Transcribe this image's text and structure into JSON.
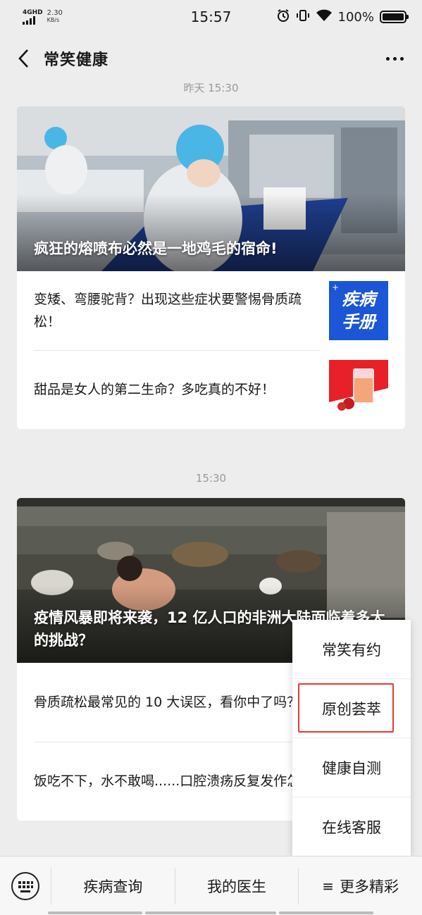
{
  "status_bar": {
    "network": "4GHD",
    "speed_value": "2.30",
    "speed_unit": "KB/s",
    "time": "15:57",
    "battery": "100%"
  },
  "nav": {
    "title": "常笑健康",
    "back_icon": "back-chevron-icon",
    "more_icon": "more-dots-icon"
  },
  "groups": [
    {
      "timestamp": "昨天 15:30",
      "hero_title": "疯狂的熔喷布必然是一地鸡毛的宿命!",
      "items": [
        {
          "title": "变矮、弯腰驼背？出现这些症状要警惕骨质疏松！",
          "thumb_text_line1": "疾病",
          "thumb_text_line2": "手册"
        },
        {
          "title": "甜品是女人的第二生命？多吃真的不好！"
        }
      ]
    },
    {
      "timestamp": "15:30",
      "hero_title": "疫情风暴即将来袭，12 亿人口的非洲大陆面临着多大的挑战？",
      "items": [
        {
          "title": "骨质疏松最常见的 10 大误区，看你中了吗？"
        },
        {
          "title": "饭吃不下，水不敢喝......口腔溃疡反复发作怎么办？"
        }
      ]
    }
  ],
  "bottom_menu": {
    "keyboard_icon": "keyboard-icon",
    "items": [
      "疾病查询",
      "我的医生",
      "更多精彩"
    ],
    "more_prefix": "≡"
  },
  "popup_menu": {
    "items": [
      "常笑有约",
      "原创荟萃",
      "健康自测",
      "在线客服"
    ],
    "highlighted_index": 1
  },
  "colors": {
    "highlight_border": "#e53935",
    "thumb_blue": "#1a56d6",
    "thumb_red": "#e8202a"
  }
}
